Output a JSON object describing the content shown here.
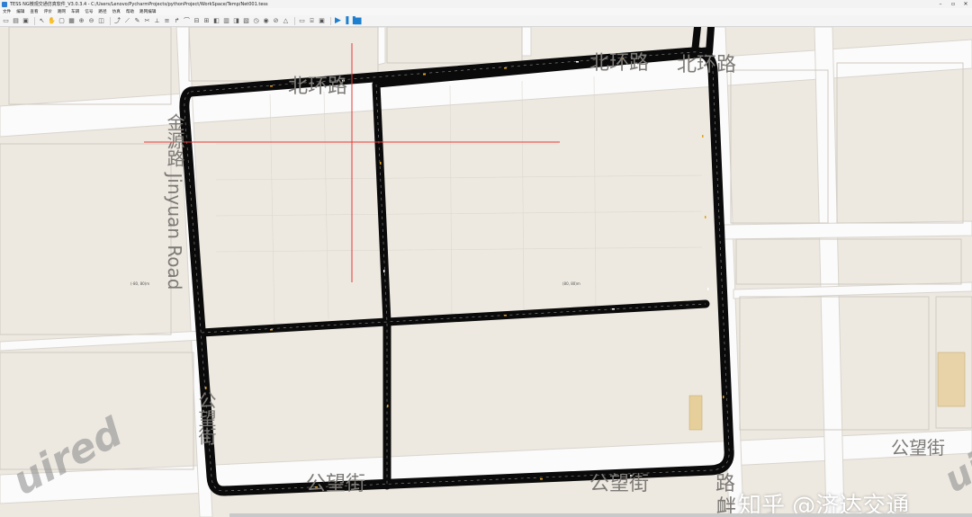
{
  "window": {
    "title": "TESS NG微观交通仿真软件_V3.0.3.4 - C:/Users/Lenovo/PycharmProjects/pythonProject/WorkSpace/Temp/Net001.tess",
    "minimize": "–",
    "maximize": "▫",
    "close": "✕"
  },
  "menu": [
    "文件",
    "编辑",
    "查看",
    "评价",
    "路网",
    "车辆",
    "信号",
    "路径",
    "仿真",
    "帮助",
    "路网编辑"
  ],
  "map": {
    "labels": {
      "north_road_1": "北环路",
      "north_road_2": "北环路",
      "west_road": "金源路 Jinyuan Road",
      "south_west": "公望街",
      "south_mid": "公望街",
      "south_low": "公望街",
      "south_right": "公望街",
      "right_vertical": "路",
      "bottom_vertical": "衅"
    },
    "coords": {
      "left": "(-80, 80)m",
      "right": "(80, 80)m"
    },
    "watermark_left": "uired",
    "watermark_right": "uired",
    "brand": "知乎 @济达交通"
  },
  "colors": {
    "map_bg": "#ede9e1",
    "minor_road": "#fbfbfb",
    "link": "#0a0a0a",
    "crosshair": "#e53935",
    "accent": "#1d7fd0"
  }
}
